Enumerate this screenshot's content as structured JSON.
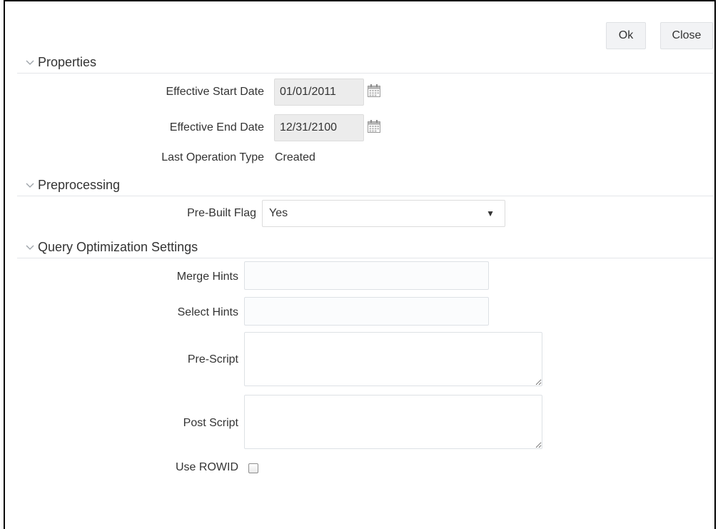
{
  "buttons": {
    "ok_label": "Ok",
    "close_label": "Close"
  },
  "sections": {
    "properties": "Properties",
    "preprocessing": "Preprocessing",
    "query_optimization": "Query Optimization Settings"
  },
  "properties": {
    "start_date_label": "Effective Start Date",
    "start_date_value": "01/01/2011",
    "end_date_label": "Effective End Date",
    "end_date_value": "12/31/2100",
    "last_op_label": "Last Operation Type",
    "last_op_value": "Created"
  },
  "preprocessing": {
    "prebuilt_label": "Pre-Built Flag",
    "prebuilt_value": "Yes",
    "dropdown_arrow": "▼"
  },
  "query": {
    "merge_hints_label": "Merge Hints",
    "merge_hints_value": "",
    "select_hints_label": "Select Hints",
    "select_hints_value": "",
    "pre_script_label": "Pre-Script",
    "pre_script_value": "",
    "post_script_label": "Post Script",
    "post_script_value": "",
    "use_rowid_label": "Use ROWID",
    "use_rowid_checked": false
  },
  "icons": {
    "section_toggle": "chevron-down-icon",
    "date_picker": "calendar-icon"
  },
  "colors": {
    "readonly_bg": "#ececec",
    "section_line": "#e4e6e9",
    "button_bg": "#f2f3f5"
  }
}
